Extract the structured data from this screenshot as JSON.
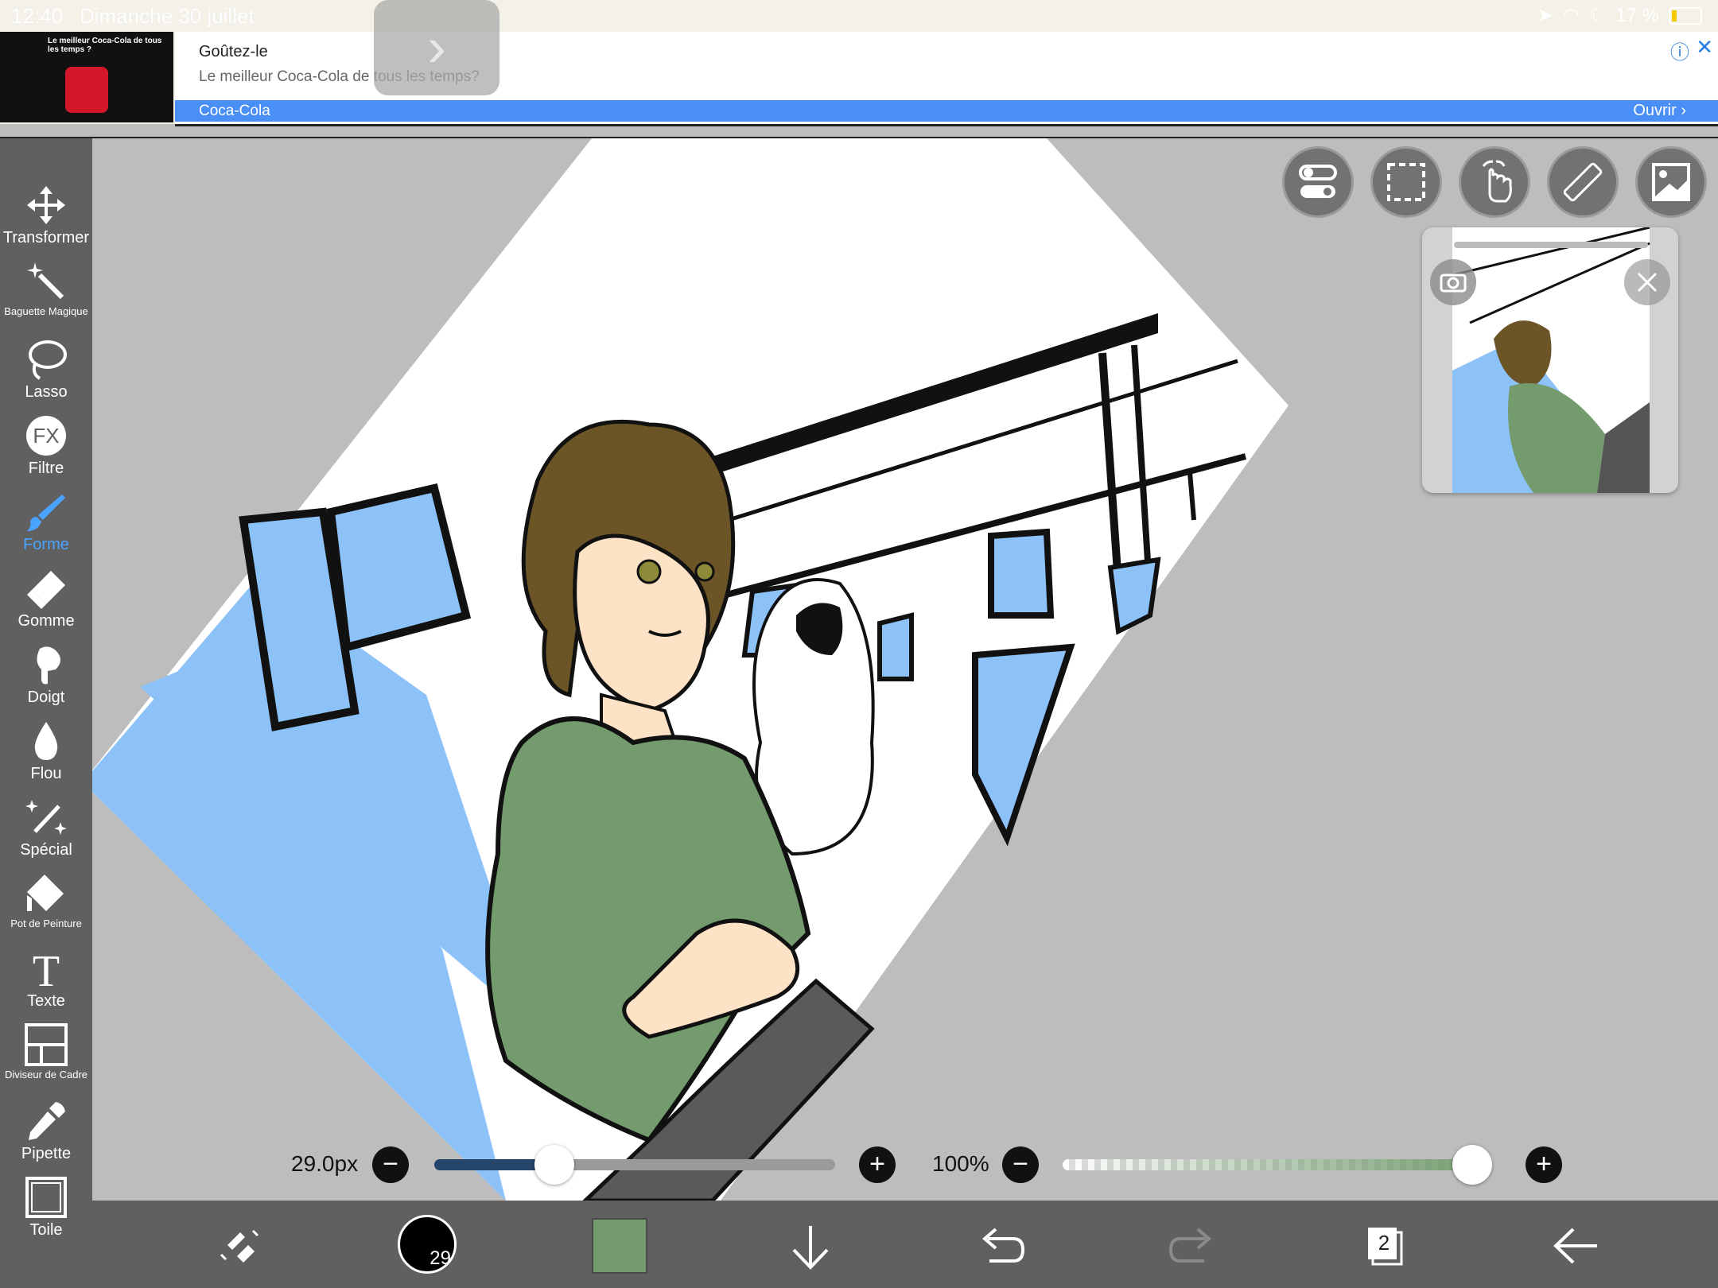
{
  "status_bar": {
    "time": "12:40",
    "date": "Dimanche 30 juillet",
    "battery": "17 %"
  },
  "ad": {
    "headline": "Goûtez-le",
    "subtitle": "Le meilleur Coca-Cola de tous les temps?",
    "brand": "Coca-Cola",
    "open_label": "Ouvrir",
    "thumb_text": "Le meilleur Coca-Cola de tous les temps ?"
  },
  "tools": [
    {
      "label": "Transformer",
      "icon": "move-icon"
    },
    {
      "label": "Baguette Magique",
      "icon": "magic-wand-icon"
    },
    {
      "label": "Lasso",
      "icon": "lasso-icon"
    },
    {
      "label": "Filtre",
      "icon": "fx-icon",
      "glyph": "FX"
    },
    {
      "label": "Forme",
      "icon": "brush-icon",
      "active": true
    },
    {
      "label": "Gomme",
      "icon": "eraser-icon"
    },
    {
      "label": "Doigt",
      "icon": "finger-icon"
    },
    {
      "label": "Flou",
      "icon": "blur-drop-icon"
    },
    {
      "label": "Spécial",
      "icon": "special-brush-icon"
    },
    {
      "label": "Pot de Peinture",
      "icon": "paint-bucket-icon"
    },
    {
      "label": "Texte",
      "icon": "text-icon",
      "glyph": "T"
    },
    {
      "label": "Diviseur de Cadre",
      "icon": "frame-divider-icon"
    },
    {
      "label": "Pipette",
      "icon": "eyedropper-icon"
    },
    {
      "label": "Toile",
      "icon": "canvas-icon"
    }
  ],
  "brush_size": {
    "label": "29.0px",
    "value": 29.0,
    "fraction": 0.3
  },
  "opacity": {
    "label": "100%",
    "value": 100,
    "fraction": 1.0
  },
  "bottom_bar": {
    "brush_badge": "29",
    "layers_count": "2"
  },
  "colors": {
    "current": "#739b6e",
    "accent": "#4aa3ff",
    "toolbar": "#606060",
    "ad_bar": "#4a8ff5"
  }
}
